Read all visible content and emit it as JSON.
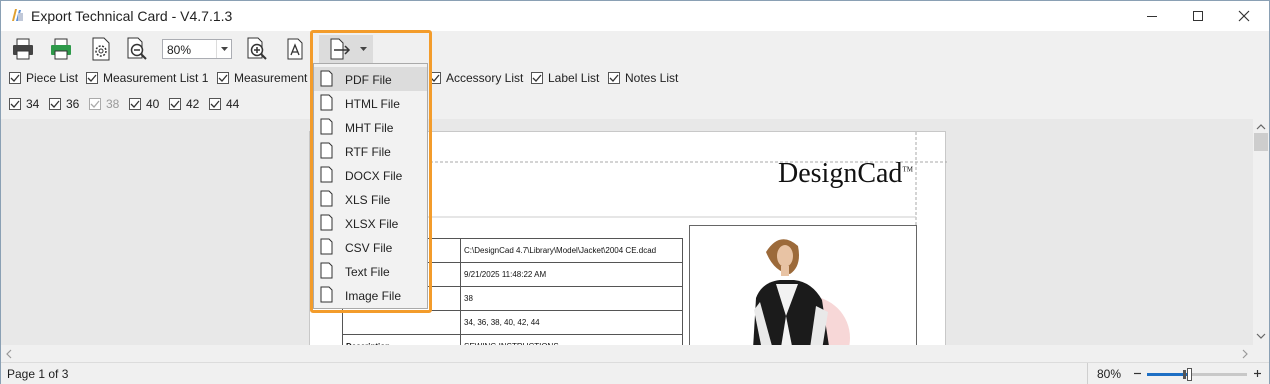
{
  "window": {
    "title": "Export Technical Card - V4.7.1.3"
  },
  "toolbar": {
    "zoom_value": "80%",
    "buttons": [
      "print-icon",
      "quick-print-icon",
      "page-setup-icon",
      "zoom-out-icon",
      "zoom-in-icon",
      "font-icon",
      "export-icon"
    ]
  },
  "checklists": {
    "row1": [
      {
        "label": "Piece List",
        "checked": true
      },
      {
        "label": "Measurement List 1",
        "checked": true
      },
      {
        "label": "Measurement",
        "checked": true
      },
      {
        "label": "Accessory List",
        "checked": true
      },
      {
        "label": "Label List",
        "checked": true
      },
      {
        "label": "Notes List",
        "checked": true
      }
    ],
    "row2": [
      {
        "label": "34",
        "checked": true,
        "disabled": false
      },
      {
        "label": "36",
        "checked": true,
        "disabled": false
      },
      {
        "label": "38",
        "checked": true,
        "disabled": true
      },
      {
        "label": "40",
        "checked": true,
        "disabled": false
      },
      {
        "label": "42",
        "checked": true,
        "disabled": false
      },
      {
        "label": "44",
        "checked": true,
        "disabled": false
      }
    ]
  },
  "export_menu": {
    "items": [
      "PDF File",
      "HTML File",
      "MHT File",
      "RTF File",
      "DOCX File",
      "XLS File",
      "XLSX File",
      "CSV File",
      "Text File",
      "Image File"
    ]
  },
  "preview": {
    "logo": "DesignCad",
    "logo_tm": "TM",
    "table": [
      {
        "label": "",
        "value": "C:\\DesignCad 4.7\\Library\\Model\\Jacket\\2004 CE.dcad"
      },
      {
        "label": "",
        "value": "9/21/2025 11:48:22 AM"
      },
      {
        "label": "",
        "value": "38"
      },
      {
        "label": "",
        "value": "34, 36, 38, 40, 42, 44"
      },
      {
        "label": "Description",
        "value": "SEWING INSTRUCTIONS"
      }
    ]
  },
  "status": {
    "page": "Page 1 of 3",
    "zoom": "80%"
  },
  "colors": {
    "highlight": "#f39c2b",
    "slider_accent": "#1e6fc4"
  }
}
